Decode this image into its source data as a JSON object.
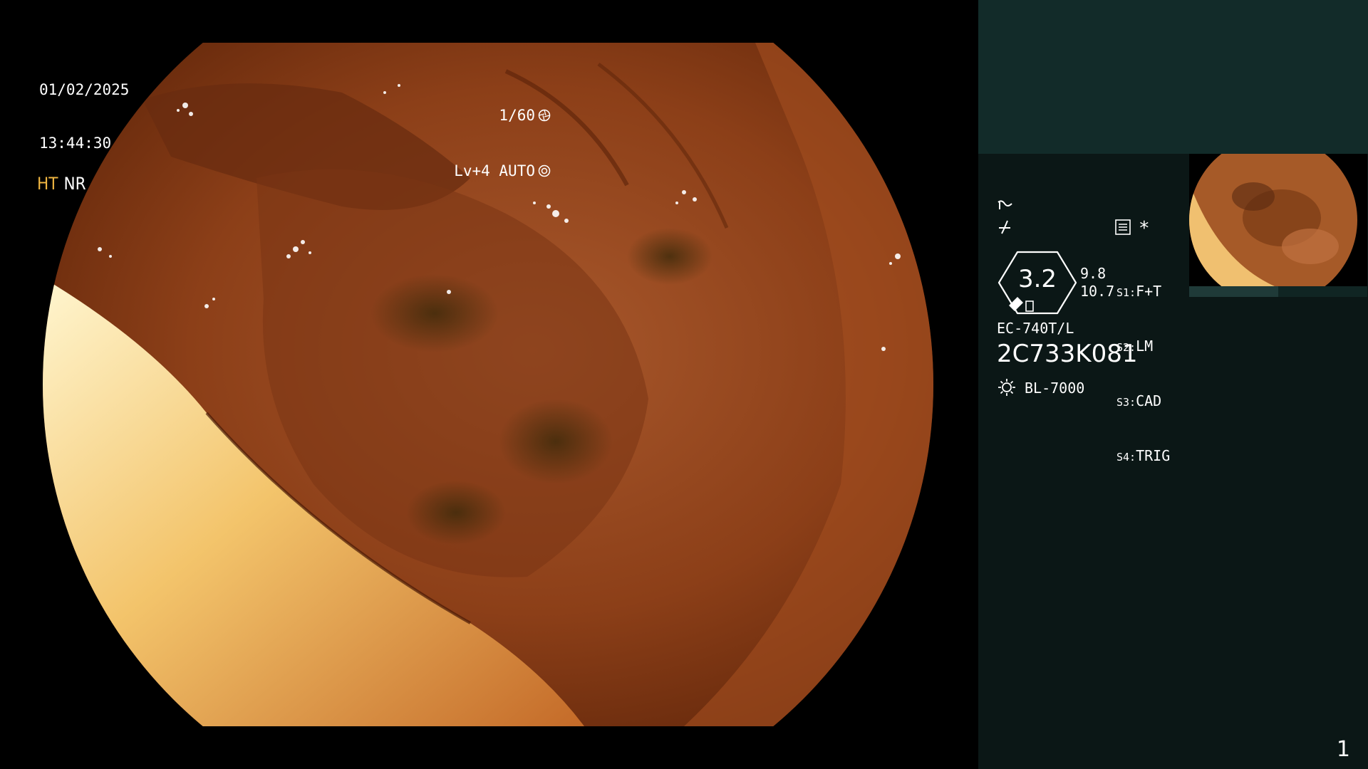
{
  "osd": {
    "date": "01/02/2025",
    "time": "13:44:30",
    "shutter": "1/60",
    "level": "Lv+4 AUTO"
  },
  "panel": {
    "mode_ht": "HT",
    "mode_nr": "NR",
    "zoom_value": "3.2",
    "numbers": [
      "9.8",
      "10.7"
    ],
    "switches": [
      {
        "key": "S1:",
        "value": "F+T"
      },
      {
        "key": "S2:",
        "value": "LM"
      },
      {
        "key": "S3:",
        "value": "CAD"
      },
      {
        "key": "S4:",
        "value": "TRIG"
      }
    ],
    "star": "*",
    "scope_model": "EC-740T/L",
    "serial": "2C733K081",
    "light_source": "BL-7000",
    "page_number": "1"
  },
  "colors": {
    "panel_bg": "#0b1716",
    "panel_top": "#122b29",
    "ht_accent": "#f0b642"
  }
}
